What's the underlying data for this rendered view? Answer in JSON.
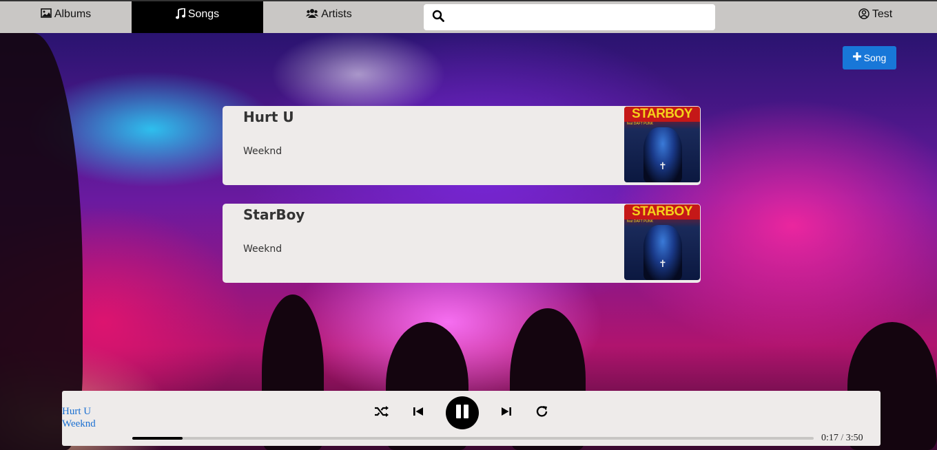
{
  "nav": {
    "items": [
      {
        "label": "Albums",
        "icon": "image-icon"
      },
      {
        "label": "Songs",
        "icon": "music-note-icon"
      },
      {
        "label": "Artists",
        "icon": "users-icon"
      }
    ],
    "active": "Songs",
    "search": {
      "placeholder": "",
      "value": ""
    },
    "user": {
      "label": "Test",
      "icon": "user-circle-icon"
    }
  },
  "add_button": {
    "label": "Song",
    "icon": "plus-icon",
    "color": "#1877d8"
  },
  "songs": [
    {
      "title": "Hurt U",
      "artist": "Weeknd",
      "cover_text": "STARBOY",
      "cover_subtext": "feat DAFT PUNK"
    },
    {
      "title": "StarBoy",
      "artist": "Weeknd",
      "cover_text": "STARBOY",
      "cover_subtext": "feat DAFT PUNK"
    }
  ],
  "player": {
    "title": "Hurt U",
    "artist": "Weeknd",
    "current_time": "0:17",
    "separator": "/",
    "duration": "3:50",
    "progress_fraction": 0.074,
    "state": "playing"
  }
}
